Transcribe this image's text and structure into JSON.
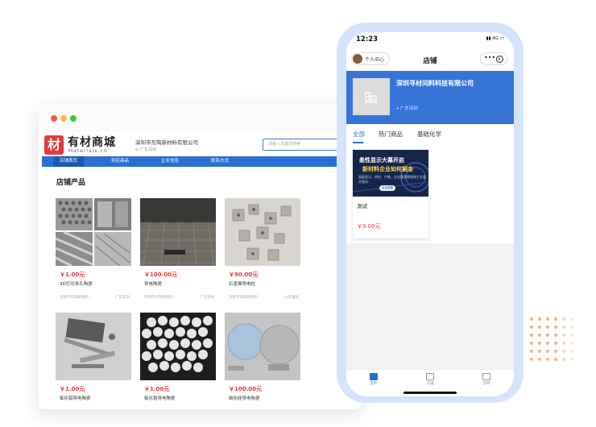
{
  "browser": {
    "logo_glyph": "材",
    "logo_text": "有材商城",
    "logo_sub": "Materials.cn",
    "shop_name": "深圳市东陶新材料有限公司",
    "shop_location": "广东深圳",
    "search_placeholder": "请输入关键词搜索",
    "nav": [
      "店铺首页",
      "供应商品",
      "企业信息",
      "联系方式"
    ],
    "section_title": "店铺产品",
    "products": [
      {
        "price": "￥1.00元",
        "name": "3D打印多孔陶瓷",
        "seller": "深圳市东陶新材料...",
        "region": "广东深圳"
      },
      {
        "price": "￥100.00元",
        "name": "导电陶瓷",
        "seller": "深圳市东陶新材料...",
        "region": "广东深圳"
      },
      {
        "price": "￥90.00元",
        "name": "石墨烯导电柱",
        "seller": "深圳市东陶新材料...",
        "region": "山东潍坊"
      },
      {
        "price": "￥1.00元",
        "name": "氧化铝导电陶瓷",
        "seller": "",
        "region": ""
      },
      {
        "price": "￥1.00元",
        "name": "氧化锆导电陶瓷",
        "seller": "",
        "region": ""
      },
      {
        "price": "￥100.00元",
        "name": "碳化硅导电陶瓷",
        "seller": "",
        "region": ""
      }
    ]
  },
  "phone": {
    "time": "12:23",
    "status_right": "▮▮ 4G ▭",
    "profile_label": "个人中心",
    "title": "店铺",
    "more_glyph": "•••",
    "shop_name": "深圳寻材问料科技有限公司",
    "shop_location": "广东深圳",
    "location_icon_glyph": "⌖",
    "tabs": [
      "全部",
      "热门商品",
      "基础化学"
    ],
    "product": {
      "banner_line1": "柔性显示大幕开启",
      "banner_line2": "新材料企业如何掘金",
      "banner_line3": "高级显示、供应、产能、企业管理规划和工艺展开面向",
      "banner_button": "点击查看",
      "name": "测试",
      "price": "￥9.00元"
    },
    "bottom_nav": [
      "名片",
      "店铺",
      "官网"
    ]
  },
  "colors": {
    "brand_blue": "#2b6fd4",
    "hero_blue": "#3674d8",
    "price_red": "#e8373a",
    "phone_frame": "#d5e3fb",
    "deco_orange": "#f7b98c"
  }
}
